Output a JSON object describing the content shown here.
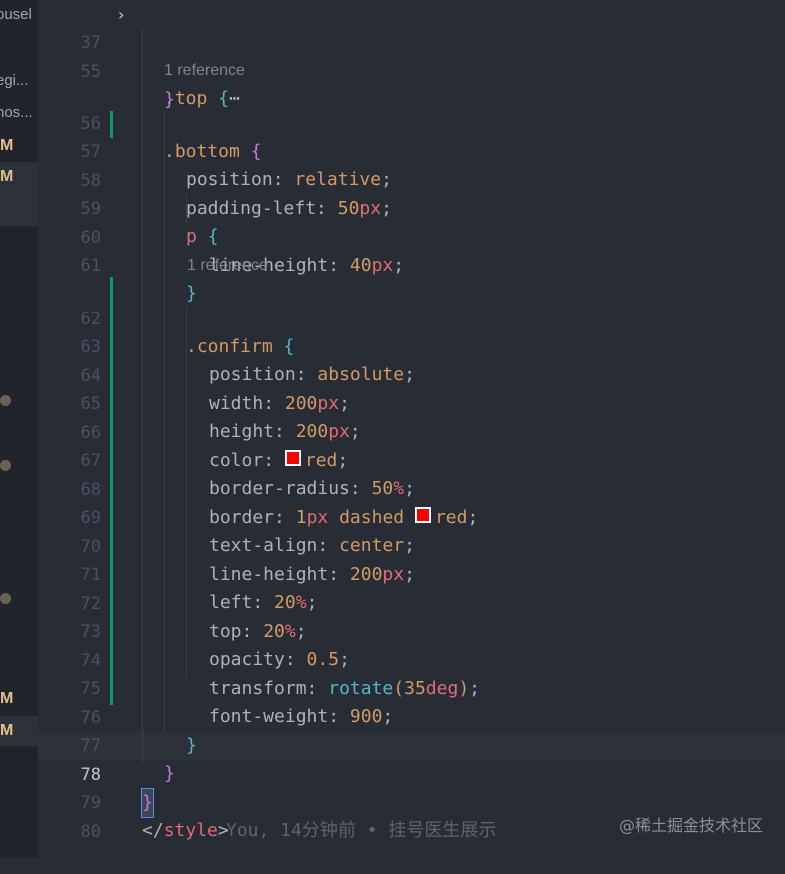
{
  "sidebar": {
    "items": [
      {
        "text": "ousel",
        "type": "file"
      },
      {
        "text": "egi...",
        "type": "file"
      },
      {
        "text": "hos...",
        "type": "file"
      },
      {
        "text": "M",
        "type": "status"
      },
      {
        "text": "M",
        "type": "status"
      },
      {
        "text": "M",
        "type": "status"
      },
      {
        "text": "M",
        "type": "status"
      }
    ]
  },
  "editor": {
    "lines": [
      {
        "num": "37",
        "code": ".top {⋯"
      },
      {
        "num": "55",
        "code": "}"
      },
      {
        "num": "56",
        "code": ".bottom {"
      },
      {
        "num": "57",
        "code": "position: relative;"
      },
      {
        "num": "58",
        "code": "padding-left: 50px;"
      },
      {
        "num": "59",
        "code": "p {"
      },
      {
        "num": "60",
        "code": "line-height: 40px;"
      },
      {
        "num": "61",
        "code": "}"
      },
      {
        "num": "62",
        "code": ".confirm {"
      },
      {
        "num": "63",
        "code": "position: absolute;"
      },
      {
        "num": "64",
        "code": "width: 200px;"
      },
      {
        "num": "65",
        "code": "height: 200px;"
      },
      {
        "num": "66",
        "code": "color: red;"
      },
      {
        "num": "67",
        "code": "border-radius: 50%;"
      },
      {
        "num": "68",
        "code": "border: 1px dashed red;"
      },
      {
        "num": "69",
        "code": "text-align: center;"
      },
      {
        "num": "70",
        "code": "line-height: 200px;"
      },
      {
        "num": "71",
        "code": "left: 20%;"
      },
      {
        "num": "72",
        "code": "top: 20%;"
      },
      {
        "num": "73",
        "code": "opacity: 0.5;"
      },
      {
        "num": "74",
        "code": "transform: rotate(35deg);"
      },
      {
        "num": "75",
        "code": "font-weight: 900;"
      },
      {
        "num": "76",
        "code": "}"
      },
      {
        "num": "77",
        "code": "}"
      },
      {
        "num": "78",
        "code": "}"
      },
      {
        "num": "79",
        "code": "</style>"
      },
      {
        "num": "80",
        "code": ""
      }
    ],
    "codelens": [
      "1 reference",
      "1 reference"
    ],
    "blame": "You, 14分钟前 • 挂号医生展示",
    "current_line": "78"
  },
  "colors": {
    "background": "#282c34",
    "sidebar": "#21252b",
    "gutter_modified": "#109868",
    "swatch_red": "#ff0000"
  },
  "watermark": "@稀土掘金技术社区"
}
